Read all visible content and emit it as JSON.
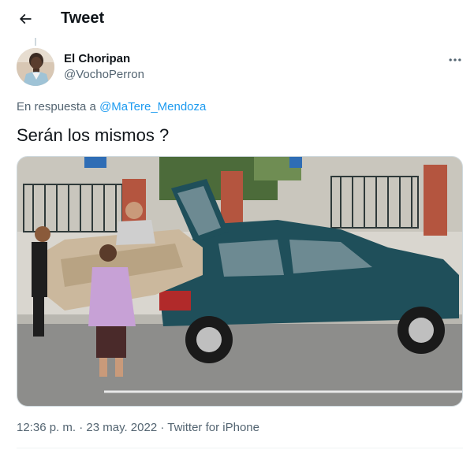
{
  "header": {
    "title": "Tweet",
    "back_icon": "arrow-left-icon"
  },
  "author": {
    "display_name": "El Choripan",
    "handle": "@VochoPerron",
    "avatar_icon": "avatar-photo"
  },
  "reply": {
    "prefix": "En respuesta a ",
    "mention": "@MaTere_Mendoza"
  },
  "tweet": {
    "text": "Serán los mismos ?"
  },
  "media": {
    "description_icon": "photo-people-loading-sofa-into-car"
  },
  "meta": {
    "time": "12:36 p. m.",
    "separator": "·",
    "date": "23 may. 2022",
    "source": "Twitter for iPhone"
  },
  "colors": {
    "accent": "#1d9bf0",
    "text": "#0f1419",
    "secondary": "#536471",
    "border": "#cfd9de"
  }
}
